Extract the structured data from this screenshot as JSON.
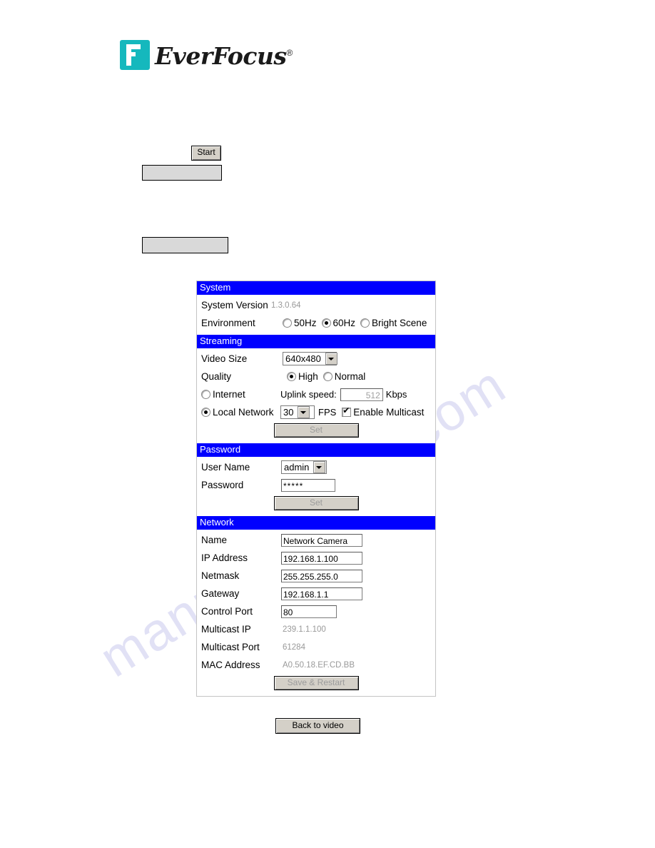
{
  "brand": {
    "name": "EverFocus",
    "registered_mark": "®",
    "logo_icon": "everfocus-f-logo",
    "accent_color": "#15b8bd"
  },
  "watermark": {
    "line_1": "manualslib",
    "line_2": "com"
  },
  "page": {
    "start_button": "Start",
    "back_to_video_button": "Back to video",
    "blank_box_1": "",
    "blank_box_2": ""
  },
  "settings": {
    "section_header_color": "#0000ff",
    "sections": [
      {
        "id": "system",
        "title": "System",
        "rows": [
          {
            "label": "System Version",
            "type": "readonly",
            "value": "1.3.0.64"
          },
          {
            "label": "Environment",
            "type": "radio-group",
            "options": [
              {
                "label": "50Hz",
                "selected": false
              },
              {
                "label": "60Hz",
                "selected": true
              },
              {
                "label": "Bright Scene",
                "selected": false
              }
            ]
          }
        ]
      },
      {
        "id": "streaming",
        "title": "Streaming",
        "rows": [
          {
            "label": "Video Size",
            "type": "select",
            "value": "640x480"
          },
          {
            "label": "Quality",
            "type": "radio-group",
            "options": [
              {
                "label": "High",
                "selected": true
              },
              {
                "label": "Normal",
                "selected": false
              }
            ]
          },
          {
            "label": "Internet",
            "type": "internet-row",
            "selected": false,
            "uplink_label": "Uplink speed:",
            "uplink_value": "512",
            "uplink_unit": "Kbps"
          },
          {
            "label": "Local Network",
            "type": "local-network-row",
            "selected": true,
            "fps_value": "30",
            "fps_label": "FPS",
            "multicast_label": "Enable Multicast",
            "multicast_checked": true
          }
        ],
        "action_button": "Set"
      },
      {
        "id": "password",
        "title": "Password",
        "rows": [
          {
            "label": "User Name",
            "type": "select",
            "value": "admin"
          },
          {
            "label": "Password",
            "type": "password",
            "value": "*****"
          }
        ],
        "action_button": "Set"
      },
      {
        "id": "network",
        "title": "Network",
        "rows": [
          {
            "label": "Name",
            "type": "text",
            "value": "Network Camera"
          },
          {
            "label": "IP Address",
            "type": "text",
            "value": "192.168.1.100"
          },
          {
            "label": "Netmask",
            "type": "text",
            "value": "255.255.255.0"
          },
          {
            "label": "Gateway",
            "type": "text",
            "value": "192.168.1.1"
          },
          {
            "label": "Control Port",
            "type": "text",
            "value": "80"
          },
          {
            "label": "Multicast IP",
            "type": "readonly",
            "value": "239.1.1.100"
          },
          {
            "label": "Multicast Port",
            "type": "readonly",
            "value": "61284"
          },
          {
            "label": "MAC Address",
            "type": "readonly",
            "value": "A0.50.18.EF.CD.BB"
          }
        ],
        "action_button": "Save & Restart"
      }
    ]
  }
}
